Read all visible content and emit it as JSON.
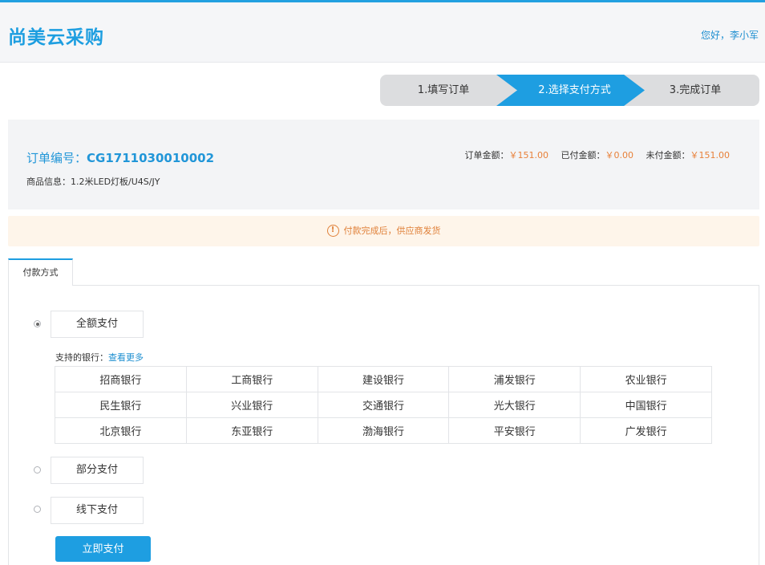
{
  "header": {
    "logo": "尚美云采购",
    "greeting": "您好，李小军"
  },
  "steps": [
    {
      "label": "1.填写订单",
      "active": false
    },
    {
      "label": "2.选择支付方式",
      "active": true
    },
    {
      "label": "3.完成订单",
      "active": false
    }
  ],
  "order": {
    "number_label": "订单编号：",
    "number": "CG1711030010002",
    "goods_label": "商品信息：",
    "goods": "1.2米LED灯板/U4S/JY",
    "order_amount_label": "订单金额：",
    "order_amount": "￥151.00",
    "paid_amount_label": "已付金额：",
    "paid_amount": "￥0.00",
    "unpaid_amount_label": "未付金额：",
    "unpaid_amount": "￥151.00"
  },
  "notice": {
    "icon": "!",
    "text": "付款完成后，供应商发货"
  },
  "tab": {
    "label": "付款方式"
  },
  "payment_options": [
    {
      "label": "全额支付",
      "selected": true
    },
    {
      "label": "部分支付",
      "selected": false
    },
    {
      "label": "线下支付",
      "selected": false
    }
  ],
  "banks": {
    "label": "支持的银行：",
    "more": "查看更多",
    "rows": [
      [
        "招商银行",
        "工商银行",
        "建设银行",
        "浦发银行",
        "农业银行"
      ],
      [
        "民生银行",
        "兴业银行",
        "交通银行",
        "光大银行",
        "中国银行"
      ],
      [
        "北京银行",
        "东亚银行",
        "渤海银行",
        "平安银行",
        "广发银行"
      ]
    ]
  },
  "pay_button": "立即支付",
  "colors": {
    "accent": "#1e9ee1",
    "warning": "#e0813a"
  }
}
